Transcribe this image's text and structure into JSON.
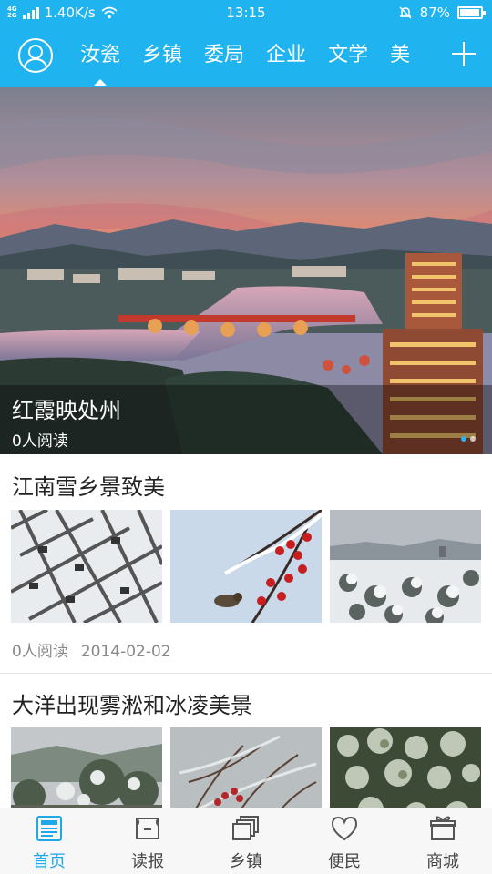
{
  "status_bar": {
    "network_top": "4G",
    "network_bottom": "2G",
    "speed": "1.40K/s",
    "time": "13:15",
    "battery": "87%",
    "battery_level": 0.87
  },
  "header": {
    "tabs": [
      "汝瓷",
      "乡镇",
      "委局",
      "企业",
      "文学",
      "美"
    ],
    "active_tab_index": 0,
    "accent_color": "#1fb3f0"
  },
  "hero": {
    "title": "红霞映处州",
    "reads": "0人阅读",
    "page_count": 2,
    "current_page_index": 0
  },
  "articles": [
    {
      "title": "江南雪乡景致美",
      "reads": "0人阅读",
      "date": "2014-02-02"
    },
    {
      "title": "大洋出现雾淞和冰凌美景"
    }
  ],
  "bottom_nav": {
    "items": [
      {
        "label": "首页",
        "icon": "news-icon"
      },
      {
        "label": "读报",
        "icon": "newspaper-icon"
      },
      {
        "label": "乡镇",
        "icon": "layers-icon"
      },
      {
        "label": "便民",
        "icon": "heart-icon"
      },
      {
        "label": "商城",
        "icon": "gift-icon"
      }
    ],
    "active_index": 0,
    "active_color": "#1fa7e8"
  }
}
